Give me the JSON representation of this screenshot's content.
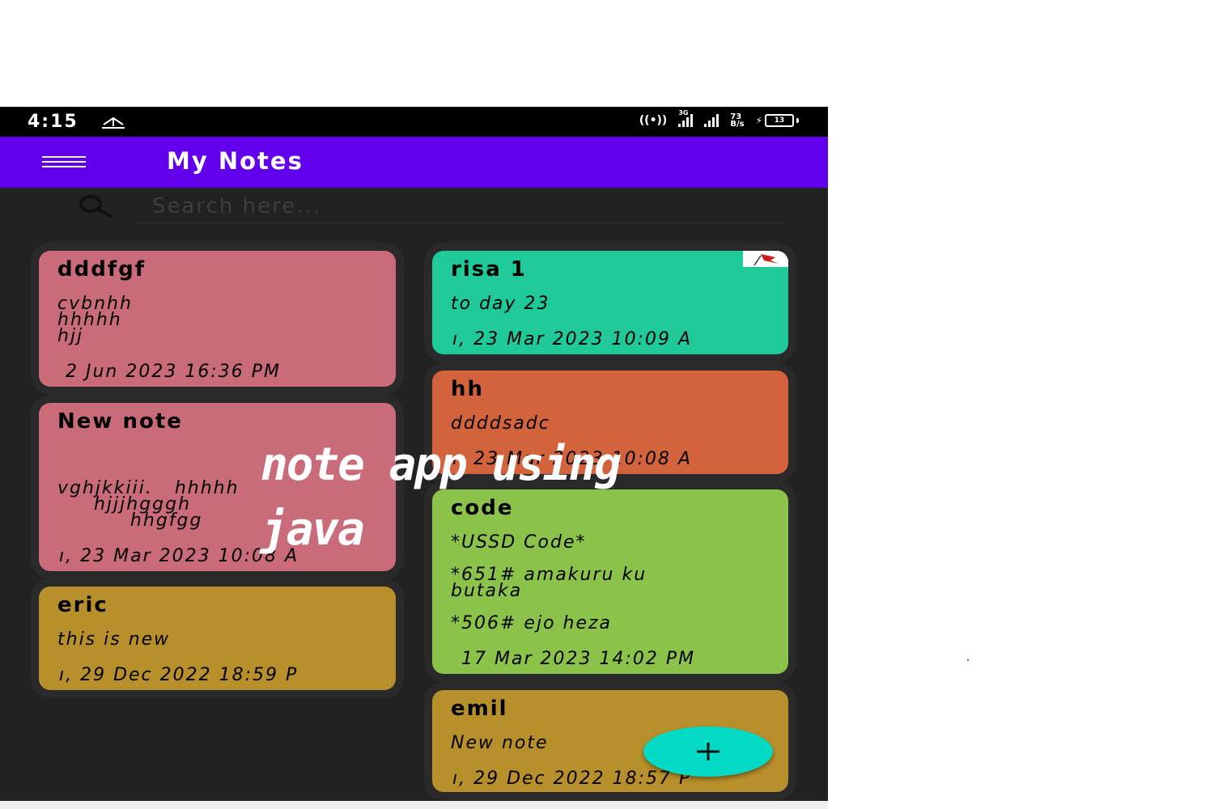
{
  "status_bar": {
    "time": "4:15",
    "net_type": "3G",
    "speed_value": "73",
    "speed_unit": "B/s",
    "battery": "13"
  },
  "app_bar": {
    "title": "My Notes"
  },
  "search": {
    "placeholder": "Search here..."
  },
  "notes_left": [
    {
      "title": "dddfgf",
      "body": "cvbnhh\nhhhhh\nhjj",
      "date": "2 Jun 2023 16:36 PM",
      "color": "#c96b79"
    },
    {
      "title": "New note",
      "body": "vghjkkiii.   hhhhh\n     hjjjhgggh\n          hhgfgg",
      "date": "ı, 23 Mar 2023 10:08 A",
      "color": "#c96b79"
    },
    {
      "title": "eric",
      "body": "this is new",
      "date": "ı, 29 Dec 2022 18:59 P",
      "color": "#b8902b"
    }
  ],
  "notes_right": [
    {
      "title": "risa 1",
      "body": "to day 23",
      "date": "ı, 23 Mar 2023 10:09 A",
      "color": "#1fc99a"
    },
    {
      "title": "hh",
      "body": "ddddsadc",
      "date": "ı, 23 Mar 2023 10:08 A",
      "color": "#d2633d"
    },
    {
      "title": "code",
      "body": "*USSD Code*\n\n*651# amakuru ku\nbutaka\n\n*506# ejo heza",
      "date": "17 Mar 2023 14:02 PM",
      "color": "#8bc34a"
    },
    {
      "title": "emil",
      "body": "New note",
      "date": "ı, 29 Dec 2022 18:57 P",
      "color": "#b8902b"
    }
  ],
  "overlay": {
    "line1": "note app using",
    "line2": "java"
  },
  "colors": {
    "app_bar": "#6200ee",
    "fab": "#03dac5",
    "background": "#222222"
  }
}
